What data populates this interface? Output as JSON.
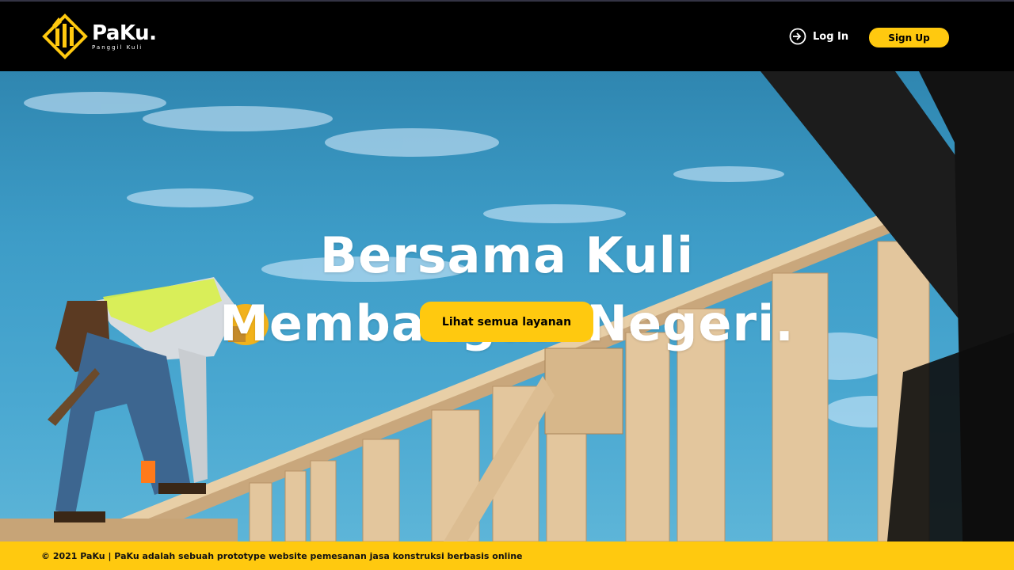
{
  "brand": {
    "name": "PaKu.",
    "tagline": "Panggil Kuli",
    "accent": "#ffc90f"
  },
  "nav": {
    "login_label": "Log In",
    "login_icon": "login-arrow-icon",
    "signup_label": "Sign Up"
  },
  "hero": {
    "headline_line1": "Bersama Kuli",
    "headline_line2": "Membangun Negeri.",
    "cta_label": "Lihat semua layanan"
  },
  "footer": {
    "text": "© 2021 PaKu | PaKu adalah sebuah prototype website pemesanan jasa konstruksi berbasis online"
  }
}
